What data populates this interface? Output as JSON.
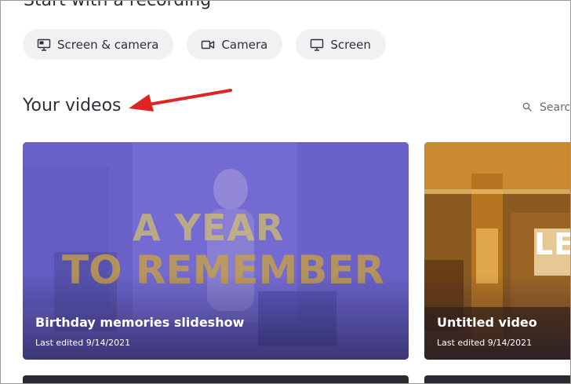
{
  "recording": {
    "section_title": "Start with a recording",
    "buttons": [
      {
        "label": "Screen & camera",
        "icon": "screen-camera-icon"
      },
      {
        "label": "Camera",
        "icon": "camera-icon"
      },
      {
        "label": "Screen",
        "icon": "monitor-icon"
      }
    ]
  },
  "videos": {
    "section_title": "Your videos",
    "search_placeholder": "Search",
    "items": [
      {
        "title": "Birthday memories slideshow",
        "last_edited": "Last edited 9/14/2021",
        "overlay_line1": "A YEAR",
        "overlay_line2": "TO REMEMBER"
      },
      {
        "title": "Untitled video",
        "last_edited": "Last edited 9/14/2021",
        "overlay_line1": "LE"
      }
    ]
  },
  "colors": {
    "annotation_arrow": "#e02424",
    "pill_bg": "#f1f1f4",
    "card1_tint": "#6a62c8"
  }
}
